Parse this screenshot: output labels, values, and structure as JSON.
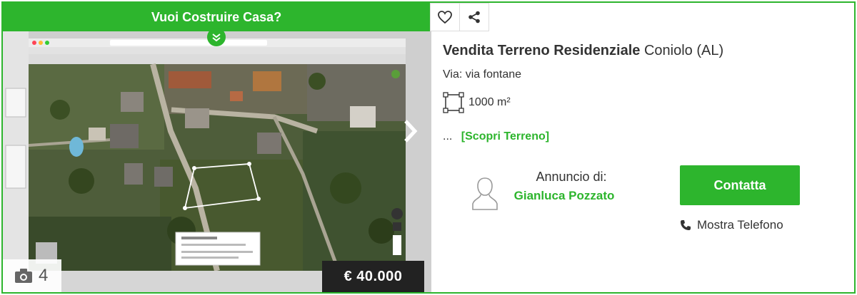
{
  "promo": {
    "label": "Vuoi Costruire Casa?"
  },
  "listing": {
    "type": "Vendita Terreno Residenziale",
    "location": "Coniolo (AL)",
    "address": "Via: via fontane",
    "area": "1000 m²",
    "more_ellipsis": "...",
    "more_link": "[Scopri Terreno]",
    "price": "€ 40.000",
    "photo_count": "4"
  },
  "agent": {
    "label": "Annuncio di:",
    "name": "Gianluca Pozzato"
  },
  "actions": {
    "contact": "Contatta",
    "phone": "Mostra Telefono"
  },
  "colors": {
    "accent": "#2db52d",
    "price_bg": "#222222"
  },
  "icons": [
    "heart-icon",
    "share-icon",
    "chevron-down-icon",
    "chevron-right-icon",
    "camera-icon",
    "area-icon",
    "user-icon",
    "phone-icon"
  ]
}
